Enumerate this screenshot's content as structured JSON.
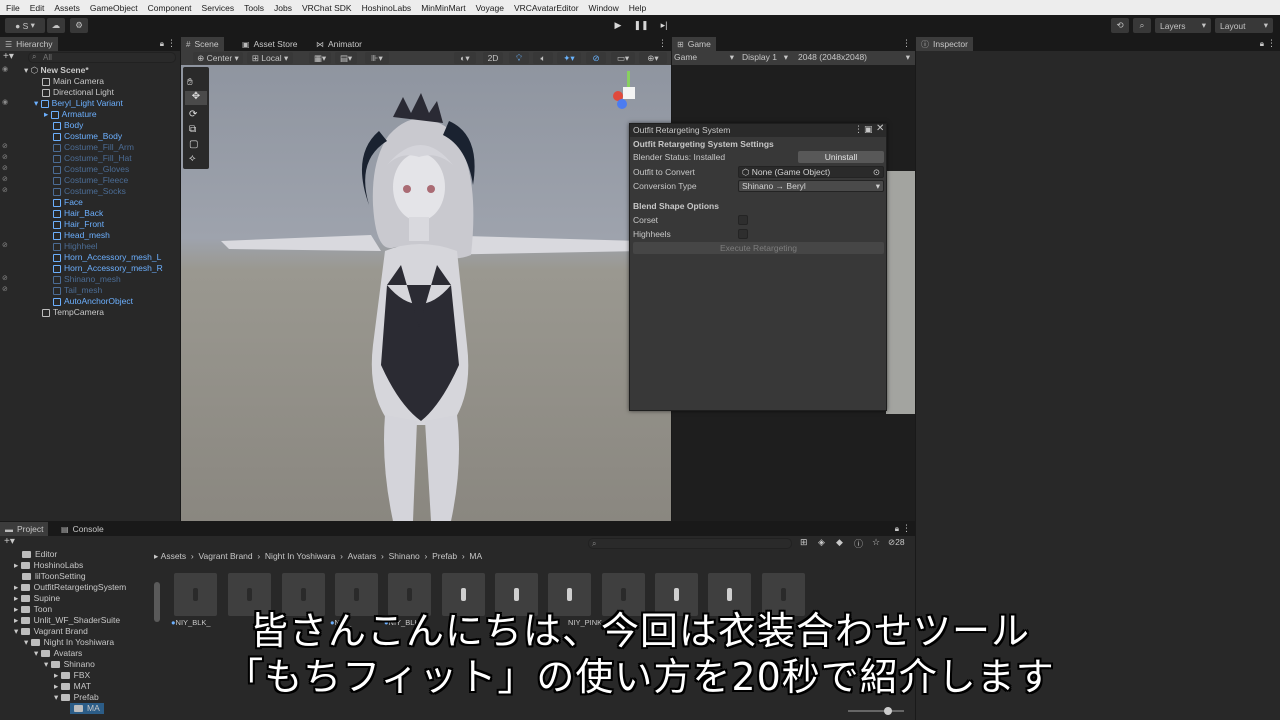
{
  "menu": [
    "File",
    "Edit",
    "Assets",
    "GameObject",
    "Component",
    "Services",
    "Tools",
    "Jobs",
    "VRChat SDK",
    "HoshinoLabs",
    "MinMinMart",
    "Voyage",
    "VRCAvatarEditor",
    "Window",
    "Help"
  ],
  "toolbar": {
    "account": "S",
    "layers": "Layers",
    "layout": "Layout"
  },
  "hierarchy": {
    "tab": "Hierarchy",
    "search_placeholder": "All",
    "items": [
      {
        "label": "New Scene*"
      },
      {
        "label": "Main Camera"
      },
      {
        "label": "Directional Light"
      },
      {
        "label": "Beryl_Light Variant"
      },
      {
        "label": "Armature"
      },
      {
        "label": "Body"
      },
      {
        "label": "Costume_Body"
      },
      {
        "label": "Costume_Fill_Arm"
      },
      {
        "label": "Costume_Fill_Hat"
      },
      {
        "label": "Costume_Gloves"
      },
      {
        "label": "Costume_Fleece"
      },
      {
        "label": "Costume_Socks"
      },
      {
        "label": "Face"
      },
      {
        "label": "Hair_Back"
      },
      {
        "label": "Hair_Front"
      },
      {
        "label": "Head_mesh"
      },
      {
        "label": "Highheel"
      },
      {
        "label": "Horn_Accessory_mesh_L"
      },
      {
        "label": "Horn_Accessory_mesh_R"
      },
      {
        "label": "Shinano_mesh"
      },
      {
        "label": "Tail_mesh"
      },
      {
        "label": "AutoAnchorObject"
      },
      {
        "label": "TempCamera"
      }
    ]
  },
  "scene": {
    "tabs": [
      "Scene",
      "Asset Store",
      "Animator"
    ],
    "pivot": "Center",
    "space": "Local",
    "mode_2d": "2D"
  },
  "game": {
    "tab": "Game",
    "mode": "Game",
    "display": "Display 1",
    "resolution": "2048 (2048x2048)"
  },
  "inspector": {
    "tab": "Inspector"
  },
  "outfit_window": {
    "title": "Outfit Retargeting System",
    "heading": "Outfit Retargeting System Settings",
    "blender_status": "Blender Status: Installed",
    "uninstall": "Uninstall",
    "outfit_label": "Outfit to Convert",
    "outfit_value": "None (Game Object)",
    "conversion_label": "Conversion Type",
    "conversion_value": "Shinano → Beryl",
    "blend_heading": "Blend Shape Options",
    "corset": "Corset",
    "highheels": "Highheels",
    "execute": "Execute Retargeting"
  },
  "project": {
    "tabs": [
      "Project",
      "Console"
    ],
    "folders": [
      "Editor",
      "HoshinoLabs",
      "lilToonSetting",
      "OutfitRetargetingSystem",
      "Supine",
      "Toon",
      "Unlit_WF_ShaderSuite",
      "Vagrant Brand",
      "Night In Yoshiwara",
      "Avatars",
      "Shinano",
      "FBX",
      "MAT",
      "Prefab",
      "MA"
    ],
    "breadcrumb": [
      "Assets",
      "Vagrant Brand",
      "Night In Yoshiwara",
      "Avatars",
      "Shinano",
      "Prefab",
      "MA"
    ],
    "count": "28",
    "assets": [
      "NIY_BLK_",
      "NIY_",
      "NIY_BLKE",
      "NIY_PINK_"
    ]
  },
  "subtitle": {
    "line1": "皆さんこんにちは、今回は衣装合わせツール",
    "line2": "「もちフィット」の使い方を20秒で紹介します"
  }
}
